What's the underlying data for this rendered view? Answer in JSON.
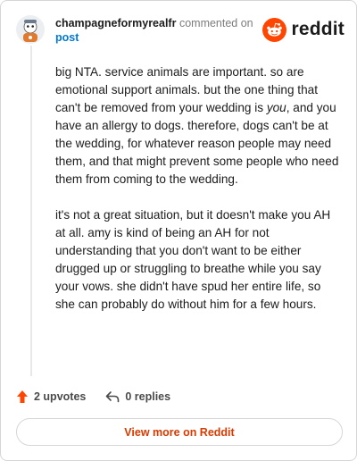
{
  "comment": {
    "username": "champagneformyrealfr",
    "action_text": "commented on",
    "post_link": "post",
    "brand": "reddit",
    "paragraph1_a": "big NTA. service animals are important. so are emotional support animals. but the one thing that can't be removed from your wedding is ",
    "paragraph1_em": "you",
    "paragraph1_b": ", and you have an allergy to dogs. therefore, dogs can't be at the wedding, for whatever reason people may need them, and that might prevent some people who need them from coming to the wedding.",
    "paragraph2": "it's not a great situation, but it doesn't make you AH at all. amy is kind of being an AH for not understanding that you don't want to be either drugged up or struggling to breathe while you say your vows. she didn't have spud her entire life, so she can probably do without him for a few hours.",
    "upvotes": "2 upvotes",
    "replies": "0 replies",
    "view_more": "View more on Reddit"
  },
  "colors": {
    "brand_orange": "#ff4500",
    "link_blue": "#0079d3",
    "view_more": "#d93a00"
  },
  "icons": [
    "avatar",
    "reddit-logo-icon",
    "upvote-icon",
    "reply-icon"
  ]
}
